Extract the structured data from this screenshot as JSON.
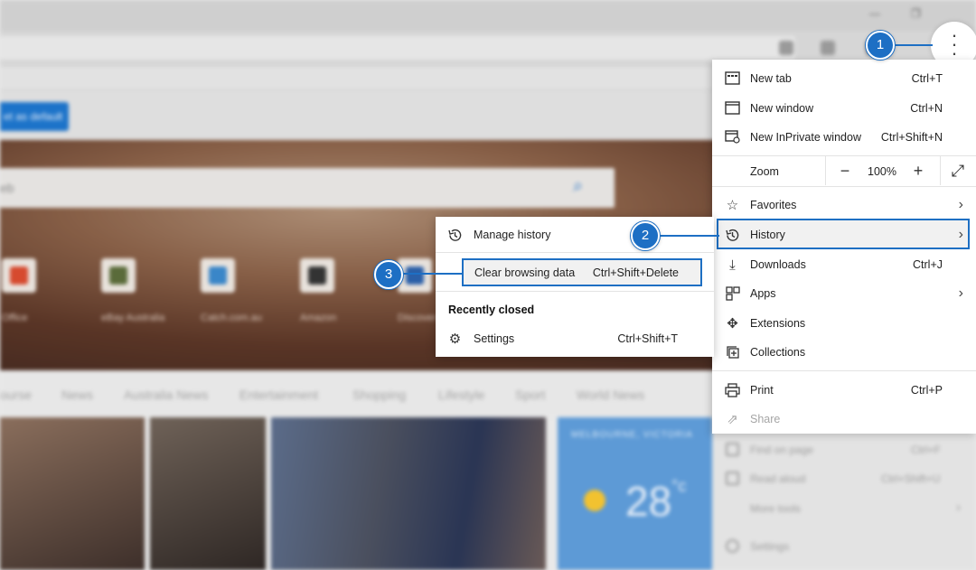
{
  "background": {
    "search_placeholder": "eb",
    "default_button": "et as default",
    "tiles": [
      {
        "label": "Office",
        "color": "#d64a2f"
      },
      {
        "label": "eBay Australia",
        "color": "#5a6b3a"
      },
      {
        "label": "Catch.com.au",
        "color": "#3a86c8"
      },
      {
        "label": "Amazon",
        "color": "#333333"
      },
      {
        "label": "Discover",
        "color": "#2a5fa8"
      }
    ],
    "tabs": [
      "ourse",
      "News",
      "Australia News",
      "Entertainment",
      "Shopping",
      "Lifestyle",
      "Sport",
      "World News"
    ],
    "weather_city": "MELBOURNE, VICTORIA",
    "weather_temp": "28",
    "weather_unit": "°c",
    "lower_menu": [
      "Find on page",
      "Read aloud",
      "More tools",
      "Settings"
    ],
    "lower_shortcuts": [
      "Ctrl+F",
      "Ctrl+Shift+U"
    ]
  },
  "menu": {
    "items": [
      {
        "label": "New tab",
        "shortcut": "Ctrl+T",
        "icon": "▭"
      },
      {
        "label": "New window",
        "shortcut": "Ctrl+N",
        "icon": "▭"
      },
      {
        "label": "New InPrivate window",
        "shortcut": "Ctrl+Shift+N",
        "icon": "◩"
      }
    ],
    "zoom": {
      "label": "Zoom",
      "minus": "−",
      "value": "100%",
      "plus": "+",
      "fullscreen": "⤢"
    },
    "favorites": "Favorites",
    "history": "History",
    "downloads": {
      "label": "Downloads",
      "shortcut": "Ctrl+J"
    },
    "apps": "Apps",
    "extensions": "Extensions",
    "collections": "Collections",
    "print": {
      "label": "Print",
      "shortcut": "Ctrl+P"
    },
    "share": "Share"
  },
  "history_submenu": {
    "manage": "Manage history",
    "clear": {
      "label": "Clear browsing data",
      "shortcut": "Ctrl+Shift+Delete"
    },
    "recent_heading": "Recently closed",
    "settings": {
      "label": "Settings",
      "shortcut": "Ctrl+Shift+T"
    }
  },
  "callouts": [
    "1",
    "2",
    "3"
  ],
  "colors": {
    "accent": "#1d6fc4",
    "menu_bg": "#ffffff"
  }
}
